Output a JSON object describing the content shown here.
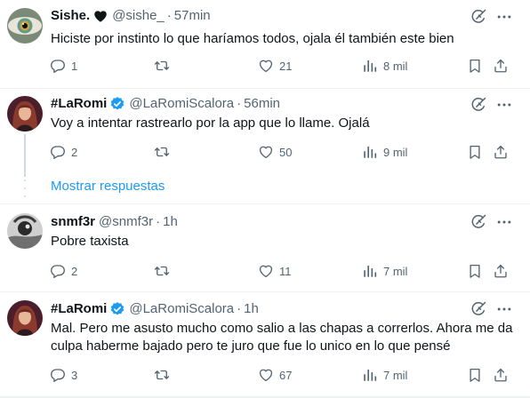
{
  "tweets": [
    {
      "display_name": "Sishe.",
      "badge_icon": "heart-badge-icon",
      "handle": "@sishe_",
      "separator": "·",
      "time": "57min",
      "text": "Hiciste por instinto lo que haríamos todos, ojala él también este bien",
      "replies": "1",
      "retweets": "",
      "likes": "21",
      "views": "8 mil"
    },
    {
      "display_name": "#LaRomi",
      "badge_icon": "verified-badge-icon",
      "handle": "@LaRomiScalora",
      "separator": "·",
      "time": "56min",
      "text": "Voy a intentar rastrearlo por la app que lo llame. Ojalá",
      "replies": "2",
      "retweets": "",
      "likes": "50",
      "views": "9 mil"
    },
    {
      "display_name": "snmf3r",
      "badge_icon": "",
      "handle": "@snmf3r",
      "separator": "·",
      "time": "1h",
      "text": "Pobre taxista",
      "replies": "2",
      "retweets": "",
      "likes": "11",
      "views": "7 mil"
    },
    {
      "display_name": "#LaRomi",
      "badge_icon": "verified-badge-icon",
      "handle": "@LaRomiScalora",
      "separator": "·",
      "time": "1h",
      "text": "Mal. Pero me asusto mucho como salio a las chapas a correrlos. Ahora me da culpa haberme bajado pero te juro que fue lo unico en lo que pensé",
      "replies": "3",
      "retweets": "",
      "likes": "67",
      "views": "7 mil"
    }
  ],
  "show_replies_label": "Mostrar respuestas",
  "colors": {
    "text": "#0f1419",
    "secondary": "#536471",
    "accent": "#1d9bf0",
    "divider": "#eff3f4"
  }
}
